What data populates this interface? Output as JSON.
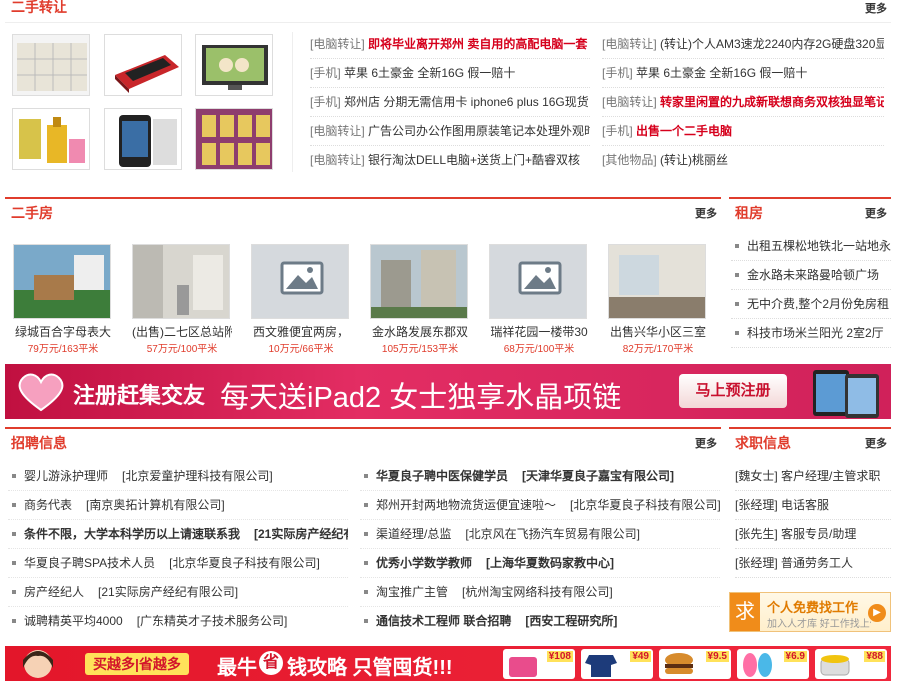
{
  "secondhand": {
    "title": "二手转让",
    "more": "更多",
    "left_links": [
      {
        "cat": "[电脑转让]",
        "text": "即将毕业离开郑州 卖自用的高配电脑一套",
        "red": true
      },
      {
        "cat": "[手机]",
        "text": "苹果 6土豪金 全新16G 假一赔十",
        "red": false
      },
      {
        "cat": "[手机]",
        "text": "郑州店 分期无需信用卡 iphone6 plus 16G现货",
        "red": false
      },
      {
        "cat": "[电脑转让]",
        "text": "广告公司办公作图用原装笔记本处理外观时尚速度",
        "red": false
      },
      {
        "cat": "[电脑转让]",
        "text": "银行淘汰DELL电脑+送货上门+酷睿双核",
        "red": false
      }
    ],
    "right_links": [
      {
        "cat": "[电脑转让]",
        "text": "(转让)个人AM3速龙2240内存2G硬盘320显卡22",
        "red": false
      },
      {
        "cat": "[手机]",
        "text": "苹果 6土豪金 全新16G 假一赔十",
        "red": false
      },
      {
        "cat": "[电脑转让]",
        "text": "转家里闲置的九成新联想商务双核独显笔记本",
        "red": true
      },
      {
        "cat": "[手机]",
        "text": "出售一个二手电脑",
        "red": true
      },
      {
        "cat": "[其他物品]",
        "text": "(转让)桃丽丝",
        "red": false
      }
    ]
  },
  "house": {
    "title": "二手房",
    "more": "更多",
    "items": [
      {
        "name": "绿城百合字母表大",
        "price": "79万元/163平米",
        "ph": false
      },
      {
        "name": "(出售)二七区总站附",
        "price": "57万元/100平米",
        "ph": false
      },
      {
        "name": "西文雅便宜两房，",
        "price": "10万元/66平米",
        "ph": true
      },
      {
        "name": "金水路发展东郡双",
        "price": "105万元/153平米",
        "ph": false
      },
      {
        "name": "瑞祥花园一楼带30",
        "price": "68万元/100平米",
        "ph": true
      },
      {
        "name": "出售兴华小区三室",
        "price": "82万元/170平米",
        "ph": false
      }
    ]
  },
  "rent": {
    "title": "租房",
    "more": "更多",
    "items": [
      "出租五棵松地铁北一站地永",
      "金水路未来路曼哈顿广场",
      "无中介费,整个2月份免房租",
      "科技市场米兰阳光 2室2厅"
    ]
  },
  "banner": {
    "text1": "注册赶集交友",
    "text2": "每天送iPad2 女士独享水晶项链",
    "button": "马上预注册"
  },
  "jobs": {
    "title": "招聘信息",
    "more": "更多",
    "left": [
      {
        "pos": "婴儿游泳护理师",
        "co": "[北京爱童护理科技有限公司]",
        "bold": false
      },
      {
        "pos": "商务代表",
        "co": "[南京奥拓计算机有限公司]",
        "bold": false
      },
      {
        "pos": "条件不限，大学本科学历以上请速联系我",
        "co": "[21实际房产经纪有限公司]",
        "bold": true
      },
      {
        "pos": "华夏良子聘SPA技术人员",
        "co": "[北京华夏良子科技有限公司]",
        "bold": false
      },
      {
        "pos": "房产经纪人",
        "co": "[21实际房产经纪有限公司]",
        "bold": false
      },
      {
        "pos": "诚聘精英平均4000",
        "co": "[广东精英才子技术服务公司]",
        "bold": false
      }
    ],
    "right": [
      {
        "pos": "华夏良子聘中医保健学员",
        "co": "[天津华夏良子嘉宝有限公司]",
        "bold": true
      },
      {
        "pos": "郑州开封两地物流货运便宜速啦～",
        "co": "[北京华夏良子科技有限公司]",
        "bold": false
      },
      {
        "pos": "渠道经理/总监",
        "co": "[北京风在飞扬汽车贸易有限公司]",
        "bold": false
      },
      {
        "pos": "优秀小学数学教师",
        "co": "[上海华夏数码家教中心]",
        "bold": true
      },
      {
        "pos": "淘宝推广主管",
        "co": "[杭州淘宝网络科技有限公司]",
        "bold": false
      },
      {
        "pos": "通信技术工程师 联合招聘",
        "co": "[西安工程研究所]",
        "bold": true
      }
    ]
  },
  "seek": {
    "title": "求职信息",
    "more": "更多",
    "items": [
      "[魏女士] 客户经理/主管求职",
      "[张经理] 电话客服",
      "[张先生] 客服专员/助理",
      "[张经理] 普通劳务工人"
    ],
    "promo_icon": "求",
    "promo_title": "个人免费找工作",
    "promo_sub": "加入人才库 好工作找上你"
  },
  "bottom": {
    "badge": "买越多|省越多",
    "slogan1": "最牛",
    "slogan_circle": "省",
    "slogan2": "钱攻略 只管囤货!!!",
    "prices": [
      "¥108",
      "¥49",
      "¥9.5",
      "¥6.9",
      "¥88"
    ]
  },
  "colors": {
    "accent": "#e03c2c",
    "banner_bg": "#d81b48",
    "promo_orange": "#f08c1a"
  }
}
